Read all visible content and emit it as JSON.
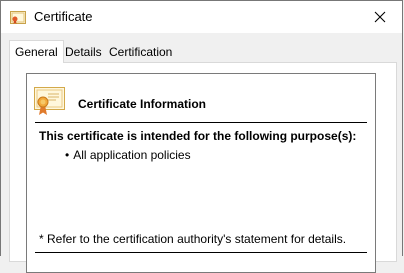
{
  "window": {
    "title": "Certificate",
    "close_icon": "close-icon"
  },
  "tabs": [
    {
      "label": "General",
      "active": true
    },
    {
      "label": "Details",
      "active": false
    },
    {
      "label": "Certification Path",
      "active": false
    }
  ],
  "general": {
    "heading": "Certificate Information",
    "purpose_heading": "This certificate is intended for the following purpose(s):",
    "purposes": [
      "All application policies"
    ],
    "note": "* Refer to the certification authority's statement for details."
  }
}
